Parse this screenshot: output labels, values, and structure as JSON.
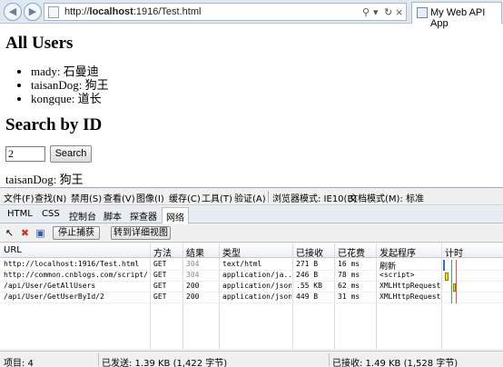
{
  "browser": {
    "url_prefix": "http://",
    "url_host": "localhost",
    "url_rest": ":1916/Test.html",
    "tab_title": "My Web API App"
  },
  "page": {
    "heading_all": "All Users",
    "users": [
      {
        "name": "mady:",
        "value": "石曼迪"
      },
      {
        "name": "taisanDog:",
        "value": "狗王"
      },
      {
        "name": "kongque:",
        "value": "道长"
      }
    ],
    "heading_search": "Search by ID",
    "search_value": "2",
    "search_button": "Search",
    "result_name": "taisanDog:",
    "result_value": "狗王"
  },
  "devtools": {
    "menu": [
      "文件(F)",
      "查找(N)",
      "禁用(S)",
      "查看(V)",
      "图像(I)",
      "缓存(C)",
      "工具(T)",
      "验证(A)",
      "浏览器模式: IE10(B)",
      "文档模式(M): 标准"
    ],
    "tabs": [
      "HTML",
      "CSS",
      "控制台",
      "脚本",
      "探查器",
      "网络"
    ],
    "active_tab": "网络",
    "stop_capture": "停止捕获",
    "detail_view": "转到详细视图",
    "columns": [
      "URL",
      "方法",
      "结果",
      "类型",
      "已接收",
      "已花费",
      "发起程序",
      "计时"
    ],
    "rows": [
      {
        "url": "http://localhost:1916/Test.html",
        "method": "GET",
        "result": "304",
        "type": "text/html",
        "received": "271 B",
        "time": "16 ms",
        "initiator": "刷新"
      },
      {
        "url": "http://common.cnblogs.com/script/...",
        "method": "GET",
        "result": "304",
        "type": "application/ja...",
        "received": "246 B",
        "time": "78 ms",
        "initiator": "<script>"
      },
      {
        "url": "/api/User/GetAllUsers",
        "method": "GET",
        "result": "200",
        "type": "application/json",
        "received": ".55 KB",
        "time": "62 ms",
        "initiator": "XMLHttpRequest"
      },
      {
        "url": "/api/User/GetUserById/2",
        "method": "GET",
        "result": "200",
        "type": "application/json",
        "received": "449 B",
        "time": "31 ms",
        "initiator": "XMLHttpRequest"
      }
    ],
    "status": {
      "items": "项目: 4",
      "sent": "已发送: 1.39 KB (1,422 字节)",
      "received": "已接收: 1.49 KB (1,528 字节)"
    }
  },
  "colors": {
    "timing_blue": "#2f6fd6",
    "timing_yellow": "#f5e100",
    "timing_green": "#3cb043",
    "timing_red": "#d9534f"
  }
}
